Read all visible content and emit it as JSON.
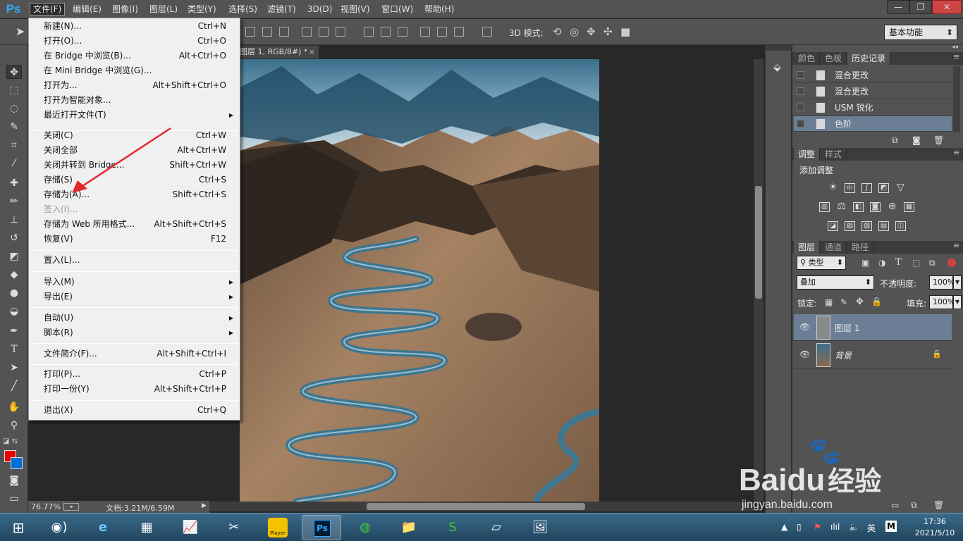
{
  "app": {
    "logo": "Ps"
  },
  "menubar": {
    "items": [
      "文件(F)",
      "编辑(E)",
      "图像(I)",
      "图层(L)",
      "类型(Y)",
      "选择(S)",
      "滤镜(T)",
      "3D(D)",
      "视图(V)",
      "窗口(W)",
      "帮助(H)"
    ],
    "active": "文件(F)"
  },
  "window_controls": {
    "minimize": "—",
    "restore": "❐",
    "close": "✕"
  },
  "options_bar": {
    "mode_label": "3D 模式:",
    "workspace": "基本功能"
  },
  "document": {
    "tab_title": "图层 1, RGB/8#) *",
    "close": "×"
  },
  "status_bar": {
    "zoom": "76.77%",
    "doc_info": "文档:3.21M/6.59M"
  },
  "file_menu": {
    "items": [
      {
        "label": "新建(N)...",
        "shortcut": "Ctrl+N"
      },
      {
        "label": "打开(O)...",
        "shortcut": "Ctrl+O"
      },
      {
        "label": "在 Bridge 中浏览(B)...",
        "shortcut": "Alt+Ctrl+O"
      },
      {
        "label": "在 Mini Bridge 中浏览(G)...",
        "shortcut": ""
      },
      {
        "label": "打开为...",
        "shortcut": "Alt+Shift+Ctrl+O"
      },
      {
        "label": "打开为智能对象...",
        "shortcut": ""
      },
      {
        "label": "最近打开文件(T)",
        "shortcut": "",
        "submenu": true
      },
      {
        "label": "关闭(C)",
        "shortcut": "Ctrl+W"
      },
      {
        "label": "关闭全部",
        "shortcut": "Alt+Ctrl+W"
      },
      {
        "label": "关闭并转到 Bridge...",
        "shortcut": "Shift+Ctrl+W"
      },
      {
        "label": "存储(S)",
        "shortcut": "Ctrl+S"
      },
      {
        "label": "存储为(A)...",
        "shortcut": "Shift+Ctrl+S"
      },
      {
        "label": "签入(I)...",
        "shortcut": "",
        "disabled": true
      },
      {
        "label": "存储为 Web 所用格式...",
        "shortcut": "Alt+Shift+Ctrl+S"
      },
      {
        "label": "恢复(V)",
        "shortcut": "F12"
      },
      {
        "label": "置入(L)...",
        "shortcut": ""
      },
      {
        "label": "导入(M)",
        "shortcut": "",
        "submenu": true
      },
      {
        "label": "导出(E)",
        "shortcut": "",
        "submenu": true
      },
      {
        "label": "自动(U)",
        "shortcut": "",
        "submenu": true
      },
      {
        "label": "脚本(R)",
        "shortcut": "",
        "submenu": true
      },
      {
        "label": "文件简介(F)...",
        "shortcut": "Alt+Shift+Ctrl+I"
      },
      {
        "label": "打印(P)...",
        "shortcut": "Ctrl+P"
      },
      {
        "label": "打印一份(Y)",
        "shortcut": "Alt+Shift+Ctrl+P"
      },
      {
        "label": "退出(X)",
        "shortcut": "Ctrl+Q"
      }
    ],
    "submenu_arrow": "▶"
  },
  "history_panel": {
    "tabs": [
      "颜色",
      "色板",
      "历史记录"
    ],
    "active_tab": "历史记录",
    "rows": [
      "混合更改",
      "混合更改",
      "USM 锐化",
      "色阶"
    ],
    "selected": "色阶"
  },
  "adjustments_panel": {
    "tabs": [
      "调整",
      "样式"
    ],
    "active_tab": "调整",
    "heading": "添加调整"
  },
  "layers_panel": {
    "tabs": [
      "图层",
      "通道",
      "路径"
    ],
    "active_tab": "图层",
    "filter_kind": "类型",
    "blend_mode": "叠加",
    "opacity_label": "不透明度:",
    "opacity": "100%",
    "lock_label": "锁定:",
    "fill_label": "填充:",
    "fill": "100%",
    "layers": [
      {
        "name": "图层 1",
        "selected": true
      },
      {
        "name": "背景",
        "locked": true
      }
    ]
  },
  "taskbar": {
    "tray_lang": "英",
    "tray_ime": "M",
    "time": "17:36",
    "date": "2021/5/10",
    "player_label": "Player"
  },
  "watermark": {
    "brand": "Bai",
    "brand2": "du",
    "suffix": "经验",
    "url": "jingyan.baidu.com"
  },
  "colors": {
    "foreground": "#e60000",
    "background": "#0070d8",
    "selection": "#6b7e96",
    "ps_blue": "#31a8ff"
  }
}
